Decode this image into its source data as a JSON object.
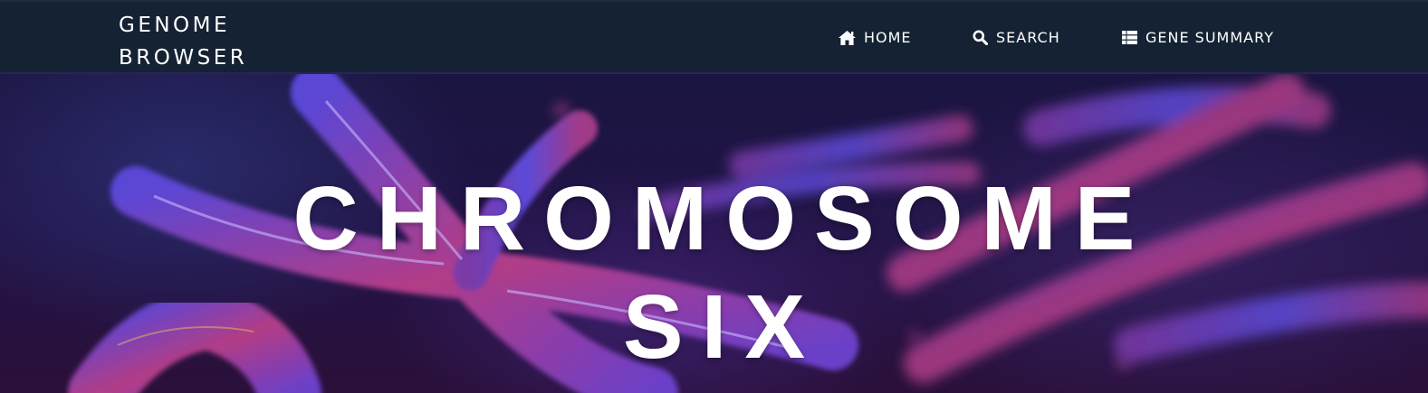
{
  "brand": {
    "line1": "GENOME",
    "line2": "BROWSER"
  },
  "nav": {
    "items": [
      {
        "label": "HOME",
        "icon": "home-icon"
      },
      {
        "label": "SEARCH",
        "icon": "search-icon"
      },
      {
        "label": "GENE SUMMARY",
        "icon": "list-icon"
      }
    ]
  },
  "hero": {
    "title_line1": "CHROMOSOME",
    "title_line2": "SIX",
    "image": "chromosome-illustration"
  },
  "colors": {
    "navbar_bg": "#142233",
    "nav_text": "#ffffff",
    "hero_bg": "#1f1545",
    "chromosome_purple": "#6a4fd8",
    "chromosome_pink": "#c0407a"
  }
}
